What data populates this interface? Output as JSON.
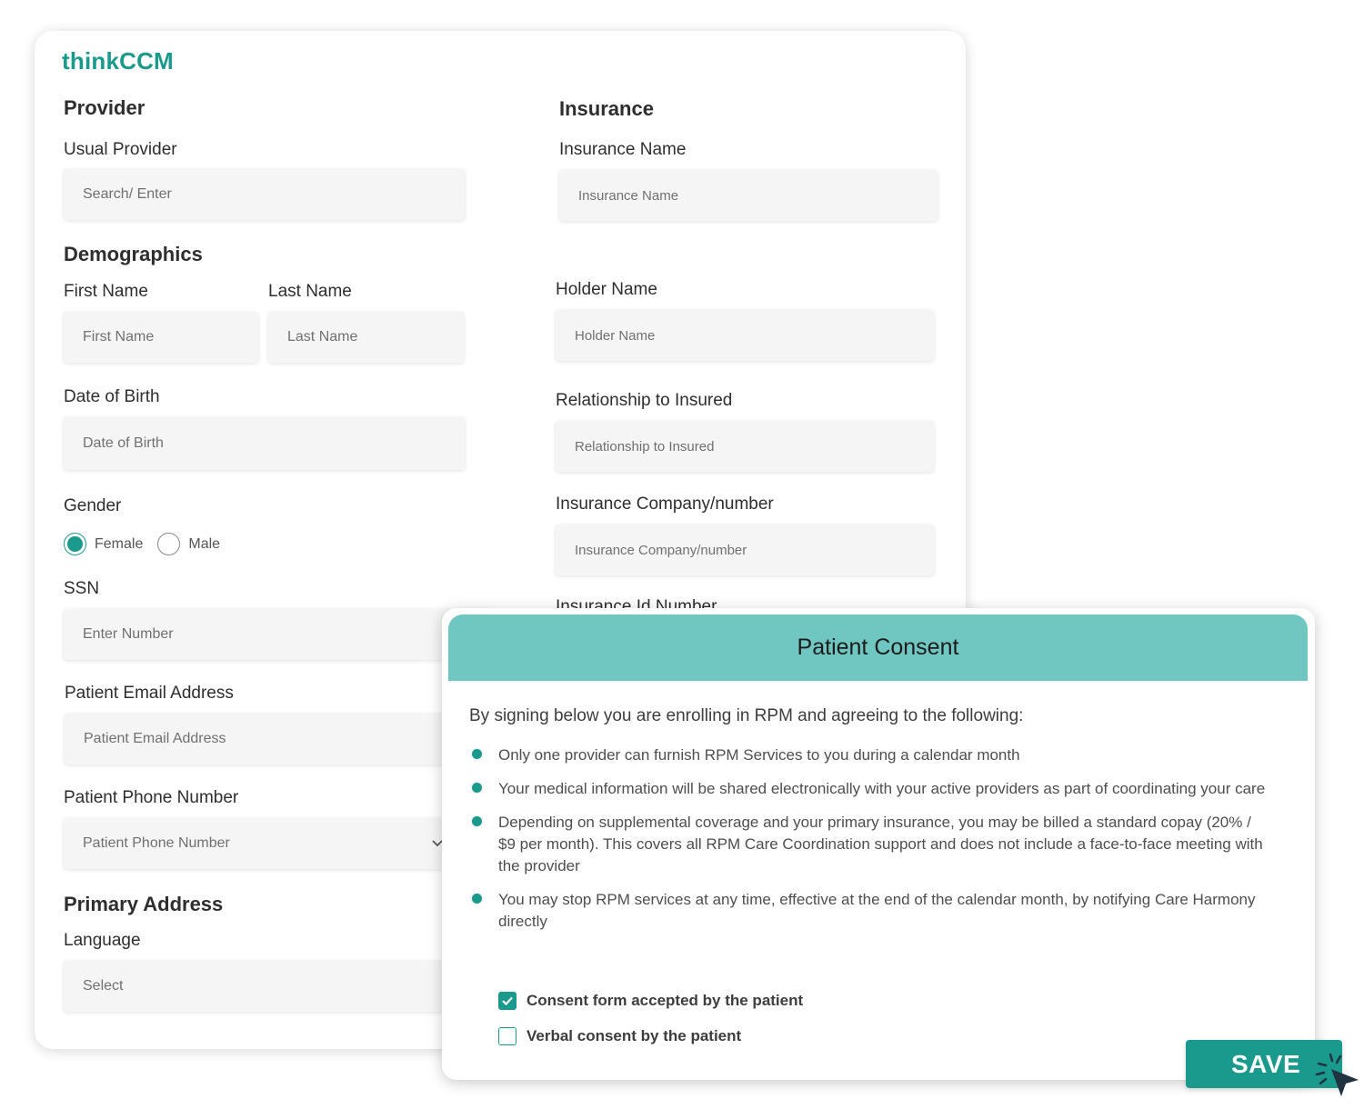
{
  "brand": {
    "name": "thinkCCM",
    "accent_color": "#1a9a8c"
  },
  "provider": {
    "title": "Provider",
    "usual_provider_label": "Usual Provider",
    "usual_provider_placeholder": "Search/ Enter"
  },
  "demographics": {
    "title": "Demographics",
    "first_name_label": "First Name",
    "first_name_placeholder": "First Name",
    "last_name_label": "Last Name",
    "last_name_placeholder": "Last Name",
    "dob_label": "Date of Birth",
    "dob_placeholder": "Date of Birth",
    "gender_label": "Gender",
    "gender_options": [
      {
        "label": "Female",
        "selected": true
      },
      {
        "label": "Male",
        "selected": false
      }
    ],
    "ssn_label": "SSN",
    "ssn_placeholder": "Enter Number",
    "email_label": "Patient Email Address",
    "email_placeholder": "Patient Email Address",
    "phone_label": "Patient Phone Number",
    "phone_placeholder": "Patient Phone Number"
  },
  "primary_address": {
    "title": "Primary Address",
    "language_label": "Language",
    "language_value": "Select"
  },
  "insurance": {
    "title": "Insurance",
    "name_label": "Insurance Name",
    "name_placeholder": "Insurance Name",
    "holder_label": "Holder Name",
    "holder_placeholder": "Holder Name",
    "relationship_label": "Relationship to Insured",
    "relationship_placeholder": "Relationship to Insured",
    "company_label": "Insurance Company/number",
    "company_placeholder": "Insurance Company/number",
    "id_label": "Insurance Id Number"
  },
  "consent_modal": {
    "title": "Patient Consent",
    "header_color": "#70c6c0",
    "intro": "By signing below you are enrolling in RPM and agreeing to the following:",
    "bullets": [
      "Only one provider can furnish RPM Services to you during a calendar month",
      "Your medical information will be shared electronically with your active providers as part of coordinating your care",
      "Depending on supplemental coverage and your primary insurance, you may be billed a standard copay (20% / $9 per month). This covers all RPM Care Coordination support and does not include a face-to-face meeting with the provider",
      "You may stop RPM services at any time, effective at the end of the calendar month, by notifying Care Harmony directly"
    ],
    "checkboxes": [
      {
        "label": "Consent form accepted by the patient",
        "checked": true
      },
      {
        "label": "Verbal consent by the patient",
        "checked": false
      }
    ]
  },
  "save_button": {
    "label": "SAVE"
  }
}
